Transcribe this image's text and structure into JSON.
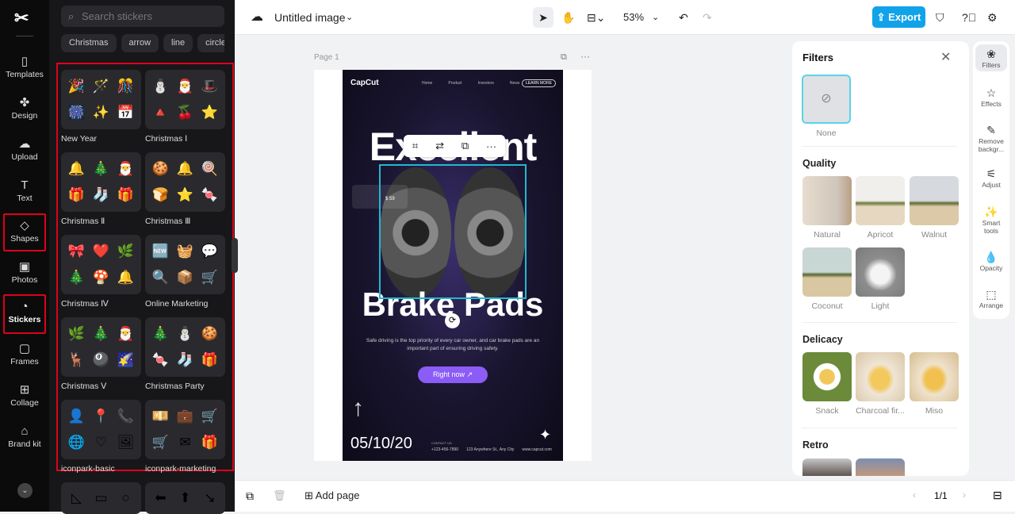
{
  "rail": {
    "items": [
      {
        "label": "Templates",
        "icon": "templates-icon"
      },
      {
        "label": "Design",
        "icon": "design-icon"
      },
      {
        "label": "Upload",
        "icon": "upload-icon"
      },
      {
        "label": "Text",
        "icon": "text-icon"
      },
      {
        "label": "Shapes",
        "icon": "shapes-icon"
      },
      {
        "label": "Photos",
        "icon": "photos-icon"
      },
      {
        "label": "Stickers",
        "icon": "stickers-icon"
      },
      {
        "label": "Frames",
        "icon": "frames-icon"
      },
      {
        "label": "Collage",
        "icon": "collage-icon"
      },
      {
        "label": "Brand kit",
        "icon": "brand-kit-icon"
      }
    ]
  },
  "stickers": {
    "search_placeholder": "Search stickers",
    "chips": [
      "Christmas",
      "arrow",
      "line",
      "circle"
    ],
    "categories": [
      {
        "label": "New Year",
        "glyphs": [
          "🎉",
          "🪄",
          "🎊",
          "🎆",
          "✨",
          "📅"
        ]
      },
      {
        "label": "Christmas Ⅰ",
        "glyphs": [
          "⛄",
          "🎅",
          "🎩",
          "🔺",
          "🍒",
          "⭐"
        ]
      },
      {
        "label": "Christmas Ⅱ",
        "glyphs": [
          "🔔",
          "🎄",
          "🎅",
          "🎁",
          "🧦",
          "🎁"
        ]
      },
      {
        "label": "Christmas Ⅲ",
        "glyphs": [
          "🍪",
          "🔔",
          "🍭",
          "🍞",
          "⭐",
          "🍬"
        ]
      },
      {
        "label": "Christmas Ⅳ",
        "glyphs": [
          "🎀",
          "❤️",
          "🌿",
          "🎄",
          "🍄",
          "🔔"
        ]
      },
      {
        "label": "Online Marketing",
        "glyphs": [
          "🆕",
          "🧺",
          "💬",
          "🔍",
          "📦",
          "🛒"
        ]
      },
      {
        "label": "Christmas Ⅴ",
        "glyphs": [
          "🌿",
          "🎄",
          "🎅",
          "🦌",
          "🎱",
          "🌠"
        ]
      },
      {
        "label": "Christmas Party",
        "glyphs": [
          "🎄",
          "⛄",
          "🍪",
          "🍬",
          "🧦",
          "🎁"
        ]
      },
      {
        "label": "iconpark-basic",
        "glyphs": [
          "👤",
          "📍",
          "📞",
          "🌐",
          "♡",
          "🖼"
        ]
      },
      {
        "label": "iconpark-marketing",
        "glyphs": [
          "💴",
          "💼",
          "🛒",
          "🛒",
          "✉",
          "🎁"
        ]
      },
      {
        "label": "",
        "glyphs": [
          "◺",
          "▭",
          "○"
        ]
      },
      {
        "label": "",
        "glyphs": [
          "⬅",
          "⬆",
          "↘"
        ]
      }
    ]
  },
  "topbar": {
    "title": "Untitled image",
    "zoom": "53%",
    "export_label": "Export"
  },
  "canvas": {
    "page_label": "Page 1"
  },
  "poster": {
    "brand": "CapCut",
    "nav": [
      "Home",
      "Product",
      "Investors",
      "News"
    ],
    "learn_more": "LEARN MORE",
    "headline1": "Excellent",
    "headline2": "Brake Pads",
    "price": "$ 59",
    "body": "Safe driving is the top priority of every car owner, and car brake pads are an important part of ensuring driving safety.",
    "cta": "Right now",
    "date": "05/10/20",
    "contact_label": "CONTACT US",
    "phone": "+123-456-7890",
    "address": "123 Anywhere St., Any City",
    "website": "www.capcut.com"
  },
  "bottombar": {
    "add_page": "Add page",
    "pagination": "1/1"
  },
  "filters": {
    "title": "Filters",
    "none_label": "None",
    "sections": [
      {
        "title": "Quality",
        "items": [
          "Natural",
          "Apricot",
          "Walnut",
          "Coconut",
          "Light"
        ]
      },
      {
        "title": "Delicacy",
        "items": [
          "Snack",
          "Charcoal fir...",
          "Miso"
        ]
      },
      {
        "title": "Retro",
        "items": []
      }
    ]
  },
  "right_rail": {
    "items": [
      "Filters",
      "Effects",
      "Remove backgr...",
      "Adjust",
      "Smart tools",
      "Opacity",
      "Arrange"
    ]
  }
}
